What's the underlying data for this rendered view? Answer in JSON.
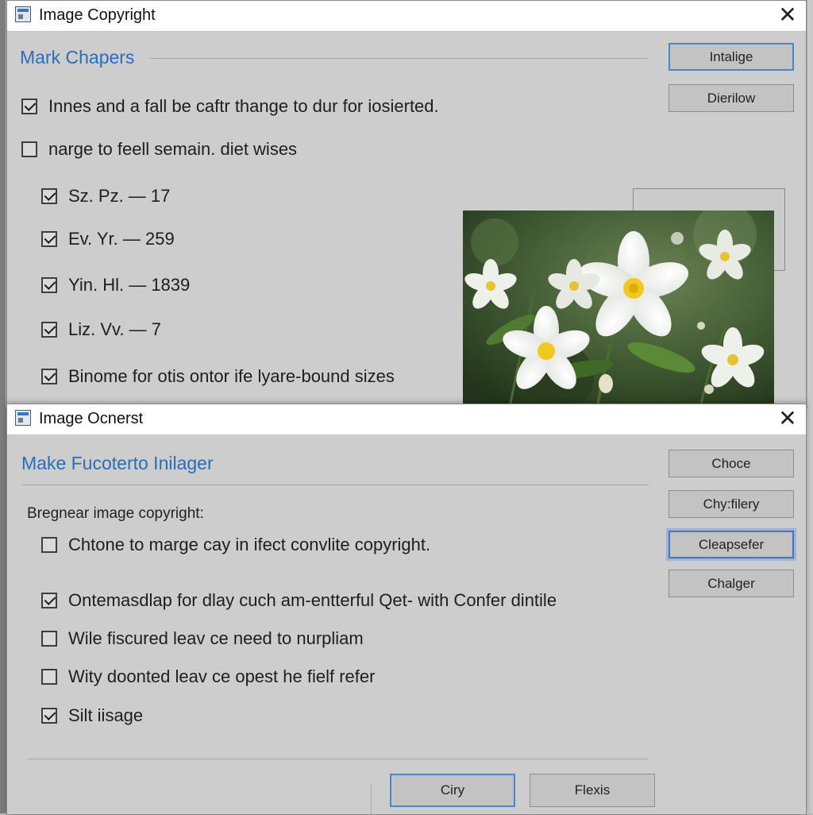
{
  "dialog1": {
    "title": "Image Copyright",
    "close_glyph": "✕",
    "section_title": "Mark Chapers",
    "buttons": [
      "Intalige",
      "Dierilow"
    ],
    "options": [
      {
        "label": "Innes and a fall be caftr thange to dur for iosierted.",
        "checked": true
      },
      {
        "label": "narge to feell semain. diet wises",
        "checked": false
      }
    ],
    "list_items": [
      {
        "label": "Sz.  Pz.  — 17",
        "checked": true
      },
      {
        "label": "Ev.  Yr.  — 259",
        "checked": true
      },
      {
        "label": "Yin.  Hl.  — 1839",
        "checked": true
      },
      {
        "label": "Liz.   Vv.  — 7",
        "checked": true
      },
      {
        "label": "Binome for otis ontor ife lyare-bound sizes",
        "checked": true
      }
    ],
    "preview_icon": "flower-photo"
  },
  "dialog2": {
    "title": "Image Ocnerst",
    "close_glyph": "✕",
    "section_title": "Make Fucoterto Inilager",
    "group_label": "Bregnear image copyright:",
    "buttons": [
      "Choce",
      "Chy:filery",
      "Cleapsefer",
      "Chalger"
    ],
    "options": [
      {
        "label": "Chtone to marge cay in ifect convlite copyright.",
        "checked": false
      },
      {
        "label": "Ontemasdlap for dlay cuch am-entterful Qet- with Confer dintile",
        "checked": true
      },
      {
        "label": "Wile fiscured leav ce need to nurpliam",
        "checked": false
      },
      {
        "label": "Wity doonted leav ce opest he fielf refer",
        "checked": false
      },
      {
        "label": "Silt iisage",
        "checked": true
      }
    ],
    "footer_buttons": [
      "Ciry",
      "Flexis"
    ]
  },
  "colors": {
    "accent": "#2a6db8",
    "dialog_bg": "#cdcdcd",
    "focus_ring": "#3a78c9"
  }
}
